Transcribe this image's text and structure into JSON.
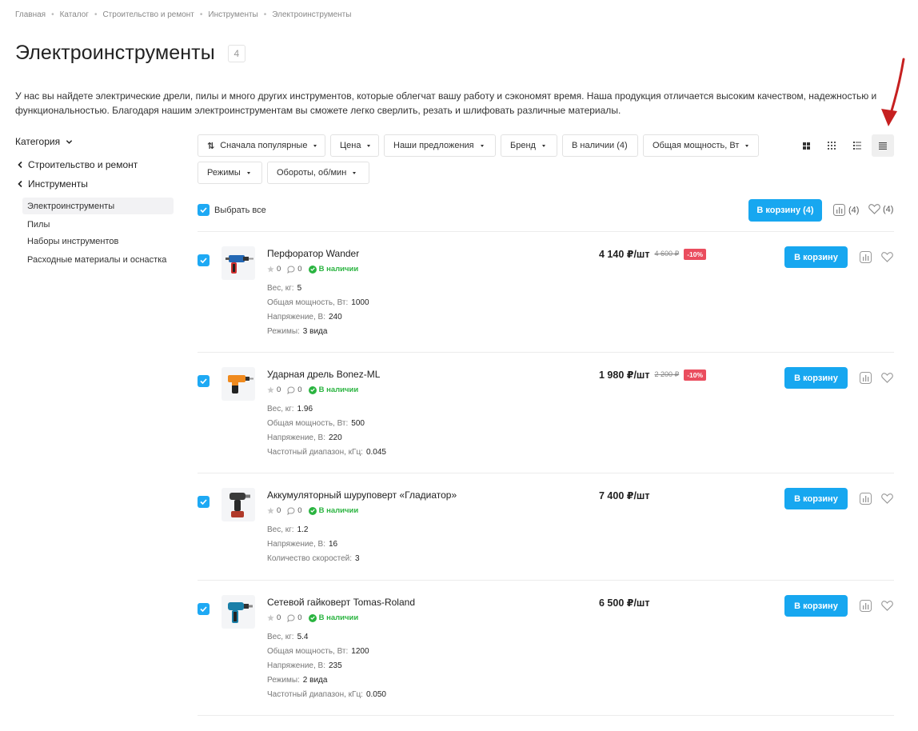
{
  "breadcrumb": [
    "Главная",
    "Каталог",
    "Строительство и ремонт",
    "Инструменты",
    "Электроинструменты"
  ],
  "page": {
    "title": "Электроинструменты",
    "count": "4",
    "description": "У нас вы найдете электрические дрели, пилы и много других инструментов, которые облегчат вашу работу и сэкономят время. Наша продукция отличается высоким качеством, надежностью и функциональностью. Благодаря нашим электроинструментам вы сможете легко сверлить, резать и шлифовать различные материалы."
  },
  "sidebar": {
    "category_label": "Категория",
    "parents": [
      "Строительство и ремонт",
      "Инструменты"
    ],
    "items": [
      {
        "label": "Электроинструменты",
        "active": true
      },
      {
        "label": "Пилы"
      },
      {
        "label": "Наборы инструментов"
      },
      {
        "label": "Расходные материалы и оснастка"
      }
    ]
  },
  "filters": {
    "sort": "Сначала популярные",
    "price": "Цена",
    "offers": "Наши предложения",
    "brand": "Бренд",
    "in_stock": "В наличии (4)",
    "power": "Общая мощность, Вт",
    "modes": "Режимы",
    "rpm": "Обороты, об/мин"
  },
  "views": [
    "grid-large-icon",
    "grid-small-icon",
    "list-detailed-icon",
    "list-compact-icon"
  ],
  "toolbar": {
    "select_all": "Выбрать все",
    "cart_all": "В корзину (4)",
    "compare_count": "(4)",
    "fav_count": "(4)"
  },
  "products": [
    {
      "name": "Перфоратор Wander",
      "rating": "0",
      "reviews": "0",
      "stock": "В наличии",
      "price": "4 140 ₽/шт",
      "old_price": "4 600 ₽",
      "discount": "-10%",
      "cart": "В корзину",
      "props": [
        {
          "k": "Вес, кг:",
          "v": "5"
        },
        {
          "k": "Общая мощность, Вт:",
          "v": "1000"
        },
        {
          "k": "Напряжение, В:",
          "v": "240"
        },
        {
          "k": "Режимы:",
          "v": "3 вида"
        }
      ]
    },
    {
      "name": "Ударная дрель Bonez-ML",
      "rating": "0",
      "reviews": "0",
      "stock": "В наличии",
      "price": "1 980 ₽/шт",
      "old_price": "2 200 ₽",
      "discount": "-10%",
      "cart": "В корзину",
      "props": [
        {
          "k": "Вес, кг:",
          "v": "1.96"
        },
        {
          "k": "Общая мощность, Вт:",
          "v": "500"
        },
        {
          "k": "Напряжение, В:",
          "v": "220"
        },
        {
          "k": "Частотный диапазон, кГц:",
          "v": "0.045"
        }
      ]
    },
    {
      "name": "Аккумуляторный шуруповерт «Гладиатор»",
      "rating": "0",
      "reviews": "0",
      "stock": "В наличии",
      "price": "7 400 ₽/шт",
      "cart": "В корзину",
      "props": [
        {
          "k": "Вес, кг:",
          "v": "1.2"
        },
        {
          "k": "Напряжение, В:",
          "v": "16"
        },
        {
          "k": "Количество скоростей:",
          "v": "3"
        }
      ]
    },
    {
      "name": "Сетевой гайковерт Tomas-Roland",
      "rating": "0",
      "reviews": "0",
      "stock": "В наличии",
      "price": "6 500 ₽/шт",
      "cart": "В корзину",
      "props": [
        {
          "k": "Вес, кг:",
          "v": "5.4"
        },
        {
          "k": "Общая мощность, Вт:",
          "v": "1200"
        },
        {
          "k": "Напряжение, В:",
          "v": "235"
        },
        {
          "k": "Режимы:",
          "v": "2 вида"
        },
        {
          "k": "Частотный диапазон, кГц:",
          "v": "0.050"
        }
      ]
    }
  ]
}
